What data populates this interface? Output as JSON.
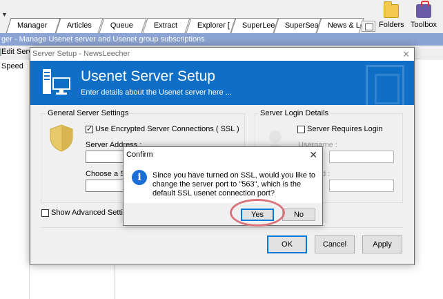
{
  "app": {
    "tabs": [
      {
        "label": "Manager"
      },
      {
        "label": "Articles"
      },
      {
        "label": "Queue"
      },
      {
        "label": "Extract"
      },
      {
        "label": "Explorer [ ?"
      },
      {
        "label": "SuperLeech"
      },
      {
        "label": "SuperSearch"
      },
      {
        "label": "News & Lo"
      }
    ],
    "toolbar": {
      "folders_label": "Folders",
      "toolbox_label": "Toolbox"
    },
    "subheader": "ger  -  Manage Usenet server and Usenet group subscriptions",
    "subtool_label": "Edit Serv",
    "column_speed": "Speed"
  },
  "setup": {
    "window_title": "Server Setup - NewsLeecher",
    "banner_title": "Usenet Server Setup",
    "banner_subtitle": "Enter details about the Usenet server here ...",
    "general": {
      "group_label": "General Server Settings",
      "ssl_label": "Use Encrypted Server Connections ( SSL )",
      "ssl_checked": true,
      "address_label": "Server Address :",
      "address_value": "",
      "choose_label": "Choose a Se",
      "choose_value": ""
    },
    "login": {
      "group_label": "Server Login Details",
      "requires_label": "Server Requires Login",
      "requires_checked": false,
      "username_label": "Username :",
      "username_value": "",
      "password_label": "d :",
      "password_value": ""
    },
    "advanced_label": "Show Advanced Settings",
    "buttons": {
      "ok": "OK",
      "cancel": "Cancel",
      "apply": "Apply"
    }
  },
  "confirm": {
    "title": "Confirm",
    "message": "Since you have turned on SSL, would you like to change the server port to \"563\", which is the default SSL usenet connection port?",
    "yes_label": "Yes",
    "no_label": "No"
  },
  "colors": {
    "banner_blue": "#0f6fc6",
    "subheader_blue": "#8ba3d2",
    "default_button_border": "#0078d7",
    "highlight_circle": "#d9747d",
    "info_icon": "#1a6ed8"
  }
}
